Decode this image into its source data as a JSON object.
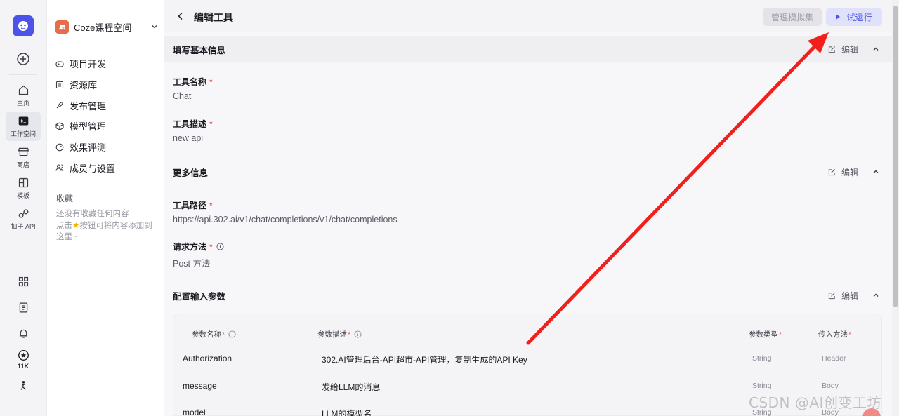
{
  "rail": {
    "items": [
      {
        "label": "主页",
        "icon": "home-icon"
      },
      {
        "label": "工作空间",
        "icon": "terminal-icon"
      },
      {
        "label": "商店",
        "icon": "store-icon"
      },
      {
        "label": "模板",
        "icon": "template-icon"
      },
      {
        "label": "扣子 API",
        "icon": "api-icon"
      }
    ],
    "star_count": "11K"
  },
  "sidebar": {
    "workspace": "Coze课程空间",
    "nav": [
      {
        "label": "项目开发",
        "icon": "gamepad-icon"
      },
      {
        "label": "资源库",
        "icon": "library-icon"
      },
      {
        "label": "发布管理",
        "icon": "rocket-icon"
      },
      {
        "label": "模型管理",
        "icon": "cube-icon"
      },
      {
        "label": "效果评测",
        "icon": "gauge-icon"
      },
      {
        "label": "成员与设置",
        "icon": "members-icon"
      }
    ],
    "favorites_title": "收藏",
    "favorites_empty_1": "还没有收藏任何内容",
    "favorites_empty_2": "点击",
    "favorites_empty_3": "按钮可将内容添加到这里~"
  },
  "header": {
    "title": "编辑工具",
    "mock_button": "管理模拟集",
    "run_button": "试运行"
  },
  "sections": {
    "basic": {
      "title": "填写基本信息",
      "edit": "编辑"
    },
    "more": {
      "title": "更多信息",
      "edit": "编辑"
    },
    "params": {
      "title": "配置输入参数",
      "edit": "编辑"
    }
  },
  "fields": {
    "tool_name_label": "工具名称",
    "tool_name_value": "Chat",
    "tool_desc_label": "工具描述",
    "tool_desc_value": "new api",
    "tool_path_label": "工具路径",
    "tool_path_value": "https://api.302.ai/v1/chat/completions/v1/chat/completions",
    "method_label": "请求方法",
    "method_value": "Post 方法"
  },
  "table": {
    "headers": {
      "name": "参数名称",
      "desc": "参数描述",
      "type": "参数类型",
      "method": "传入方法"
    },
    "rows": [
      {
        "name": "Authorization",
        "desc": "302.AI管理后台-API超市-API管理，复制生成的API Key",
        "type": "String",
        "method": "Header"
      },
      {
        "name": "message",
        "desc": "发给LLM的消息",
        "type": "String",
        "method": "Body"
      },
      {
        "name": "model",
        "desc": "LLM的模型名",
        "type": "String",
        "method": "Body"
      }
    ]
  },
  "watermark": "CSDN @AI创变工坊",
  "colors": {
    "accent": "#4d53e8",
    "annotation_arrow": "#f0201c",
    "required": "#e53935"
  }
}
